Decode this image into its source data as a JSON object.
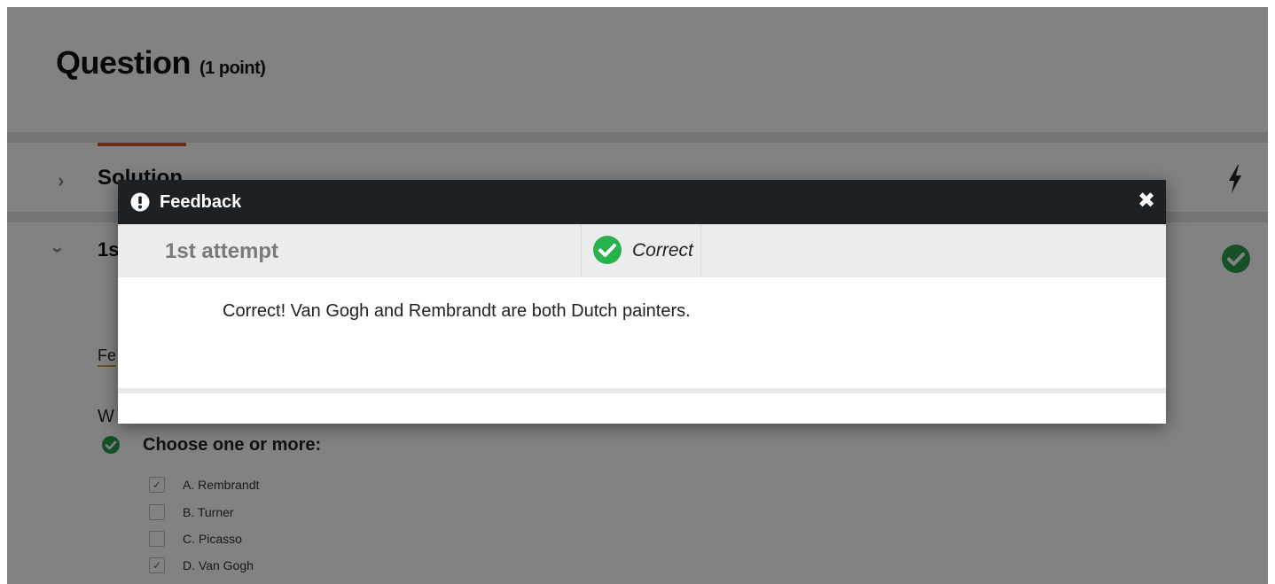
{
  "question": {
    "title": "Question",
    "points": "(1 point)"
  },
  "solution": {
    "title": "Solution"
  },
  "attempt_section": {
    "title": "1s"
  },
  "background": {
    "feedback_link_partial": "Fe",
    "question_text_partial": "W",
    "choose_label": "Choose one or more:",
    "options": [
      {
        "label": "A. Rembrandt",
        "checked": true
      },
      {
        "label": "B. Turner",
        "checked": false
      },
      {
        "label": "C. Picasso",
        "checked": false
      },
      {
        "label": "D. Van Gogh",
        "checked": true
      }
    ]
  },
  "modal": {
    "title": "Feedback",
    "close_symbol": "✖",
    "attempt_label": "1st attempt",
    "status": "Correct",
    "feedback_text": "Correct! Van Gogh and Rembrandt are both Dutch painters."
  },
  "colors": {
    "accent": "#d9583b",
    "success": "#2e9b4f",
    "success_modal": "#28b24b",
    "modal_header": "#1e2124",
    "overlay": "rgba(0,0,0,0.49)"
  },
  "icons": {
    "warning": "exclamation-circle-icon",
    "close": "close-icon",
    "correct": "check-circle-icon",
    "bolt": "lightning-bolt-icon",
    "chevron_right": "chevron-right-icon",
    "chevron_down": "chevron-down-icon"
  }
}
